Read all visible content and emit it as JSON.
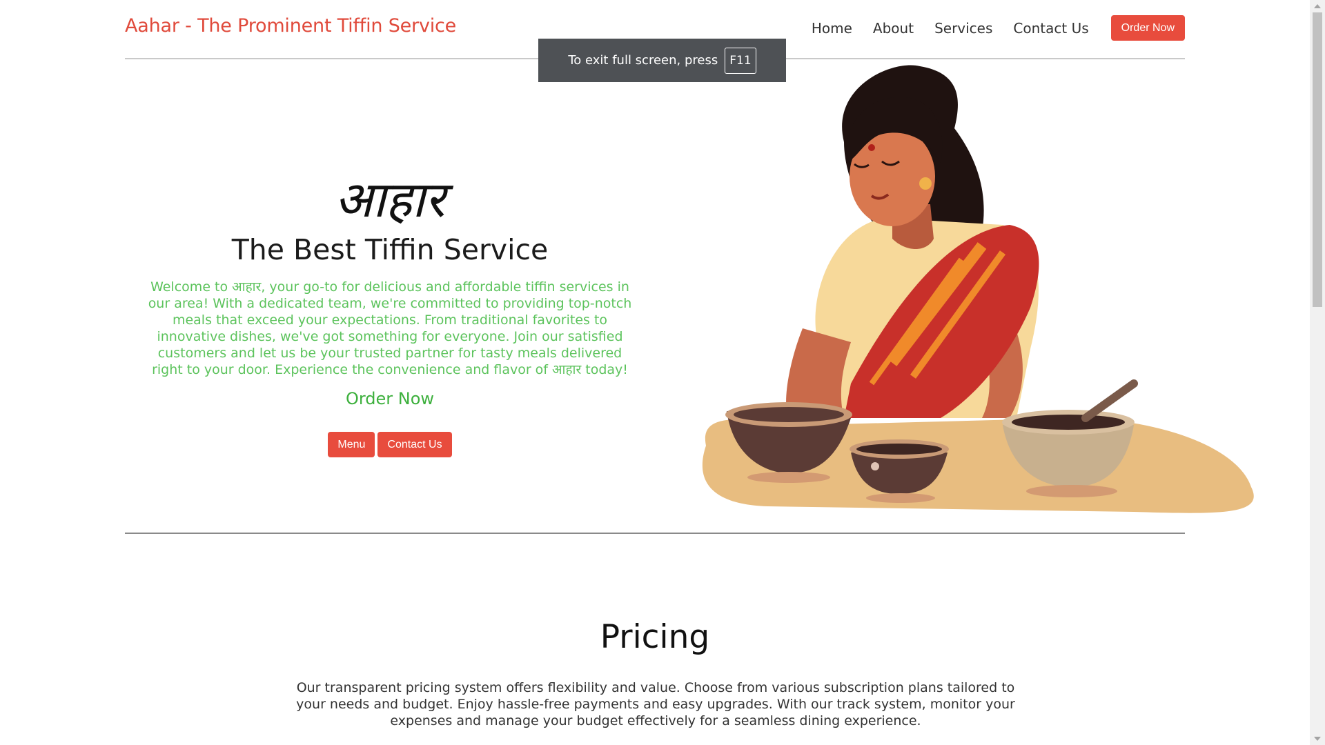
{
  "header": {
    "brand": "Aahar - The Prominent Tiffin Service",
    "nav": [
      "Home",
      "About",
      "Services",
      "Contact Us"
    ],
    "order_button": "Order Now"
  },
  "fullscreen_toast": {
    "text": "To exit full screen, press",
    "key": "F11"
  },
  "hero": {
    "logo_text": "आहार",
    "title": "The Best Tiffin Service",
    "description": "Welcome to आहार, your go-to for delicious and affordable tiffin services in our area! With a dedicated team, we're committed to providing top-notch meals that exceed your expectations. From traditional favorites to innovative dishes, we've got something for everyone. Join our satisfied customers and let us be your trusted partner for tasty meals delivered right to your door. Experience the convenience and flavor of आहार today!",
    "order_link": "Order Now",
    "buttons": [
      "Menu",
      "Contact Us"
    ]
  },
  "pricing": {
    "title": "Pricing",
    "description": "Our transparent pricing system offers flexibility and value. Choose from various subscription plans tailored to your needs and budget. Enjoy hassle-free payments and easy upgrades. With our track system, monitor your expenses and manage your budget effectively for a seamless dining experience."
  },
  "colors": {
    "brand_red": "#e04a3b",
    "button_red": "#e84c3d",
    "hero_green": "#5cc35c"
  }
}
